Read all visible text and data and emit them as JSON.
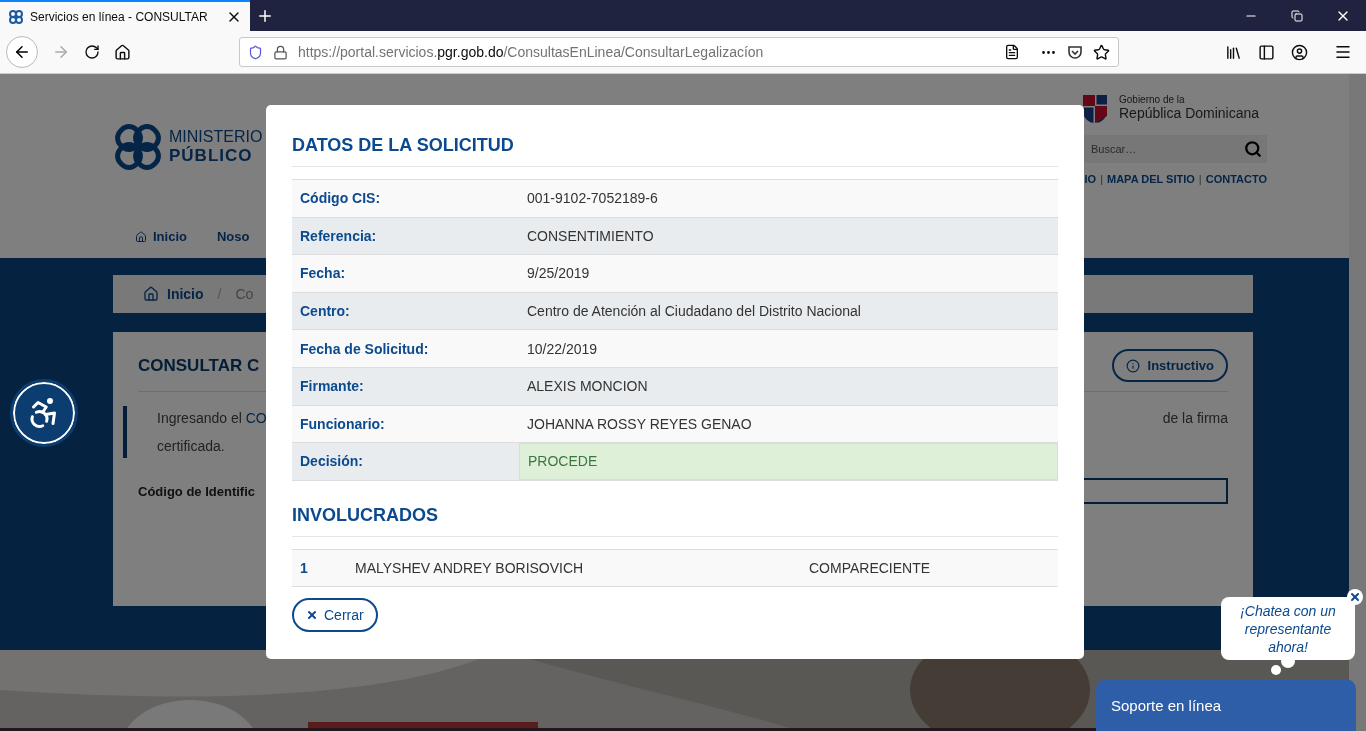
{
  "browser": {
    "tab_title": "Servicios en línea - CONSULTAR",
    "url": {
      "before": "https://portal.servicios.",
      "domain": "pgr.gob.do",
      "after": "/ConsultasEnLinea/ConsultarLegalizacíon"
    }
  },
  "page": {
    "logo": [
      "MINISTERIO",
      "PÚBLICO"
    ],
    "gov": [
      "Gobierno de la",
      "República Dominicana"
    ],
    "search": {
      "placeholder": "Buscar…"
    },
    "top_links": [
      "IO",
      "MAPA DEL SITIO",
      "CONTACTO"
    ],
    "link_separator": "|",
    "nav": [
      "Inicio",
      "Noso"
    ],
    "breadcrumb": [
      "Inicio",
      "Co"
    ],
    "breadcrumb_separator": "/",
    "card": {
      "title": "CONSULTAR C",
      "button": "Instructivo",
      "intro_start": "Ingresando el",
      "intro_link": "CO",
      "intro_end": "de la firma",
      "intro_line2": "certificada.",
      "field_label": "Código de Identific"
    }
  },
  "modal": {
    "title": "DATOS DE LA SOLICITUD",
    "rows": [
      {
        "label": "Código CIS:",
        "value": "001-9102-7052189-6",
        "kind": "plain"
      },
      {
        "label": "Referencia:",
        "value": "CONSENTIMIENTO",
        "kind": "plain"
      },
      {
        "label": "Fecha:",
        "value": "9/25/2019",
        "kind": "plain"
      },
      {
        "label": "Centro:",
        "value": "Centro de Atención al Ciudadano del Distrito Nacional",
        "kind": "plain"
      },
      {
        "label": "Fecha de Solicitud:",
        "value": "10/22/2019",
        "kind": "plain"
      },
      {
        "label": "Firmante:",
        "value": "ALEXIS MONCION",
        "kind": "plain"
      },
      {
        "label": "Funcionario:",
        "value": "JOHANNA ROSSY REYES GENAO",
        "kind": "plain"
      },
      {
        "label": "Decisión:",
        "value": "PROCEDE",
        "kind": "success"
      }
    ],
    "section": "INVOLUCRADOS",
    "people": [
      {
        "number": "1",
        "name": "MALYSHEV ANDREY BORISOVICH",
        "role": "COMPARECIENTE"
      }
    ],
    "close": "Cerrar"
  },
  "chat": {
    "bubble": "¡Chatea con un representante ahora!",
    "bar": "Soporte en línea"
  }
}
